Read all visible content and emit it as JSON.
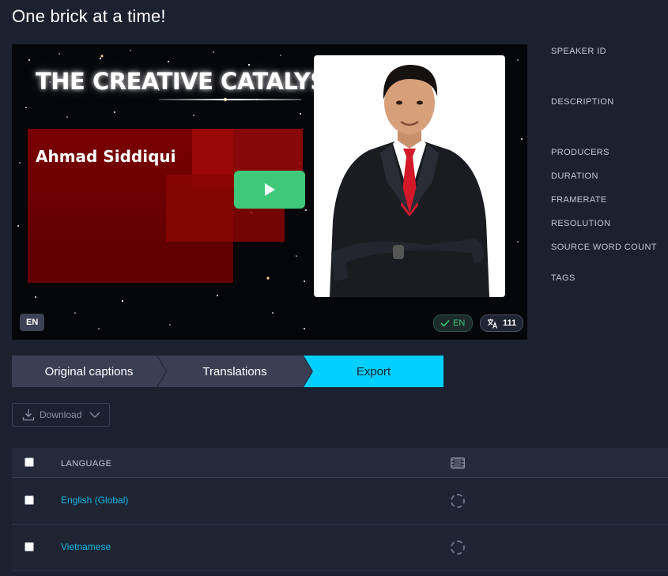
{
  "page": {
    "title": "One brick at a time!"
  },
  "video": {
    "overlay_title": "THE CREATIVE CATALYST",
    "speaker_name": "Ahmad Siddiqui",
    "language_badge": "EN",
    "verified_language": "EN",
    "translation_count": "111",
    "play_button": "play-icon"
  },
  "metadata": {
    "labels": [
      "SPEAKER ID",
      "DESCRIPTION",
      "PRODUCERS",
      "DURATION",
      "FRAMERATE",
      "RESOLUTION",
      "SOURCE WORD COUNT",
      "TAGS"
    ]
  },
  "steps": [
    {
      "label": "Original captions",
      "active": false
    },
    {
      "label": "Translations",
      "active": false
    },
    {
      "label": "Export",
      "active": true
    }
  ],
  "download": {
    "label": "Download"
  },
  "table": {
    "header": {
      "language": "LANGUAGE",
      "media_icon": "film-icon"
    },
    "rows": [
      {
        "language": "English (Global)",
        "status": "loading"
      },
      {
        "language": "Vietnamese",
        "status": "loading"
      }
    ]
  },
  "colors": {
    "background": "#1c2130",
    "accent": "#00cfff",
    "play": "#3fc77a",
    "link": "#18b8ea"
  }
}
